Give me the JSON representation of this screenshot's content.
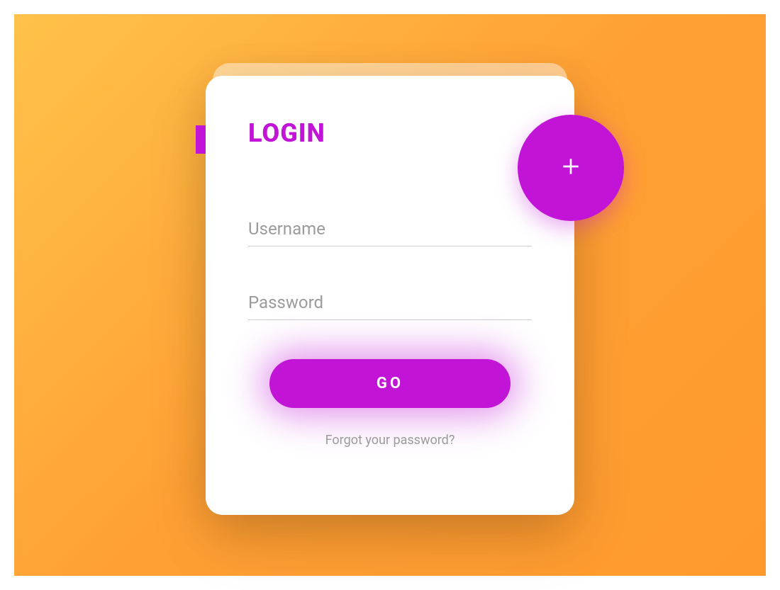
{
  "login": {
    "title": "LOGIN",
    "username_placeholder": "Username",
    "password_placeholder": "Password",
    "submit_label": "GO",
    "forgot_label": "Forgot your password?"
  },
  "colors": {
    "accent": "#c114d6",
    "gradient_start": "#ffc24a",
    "gradient_end": "#ff9a2e"
  }
}
